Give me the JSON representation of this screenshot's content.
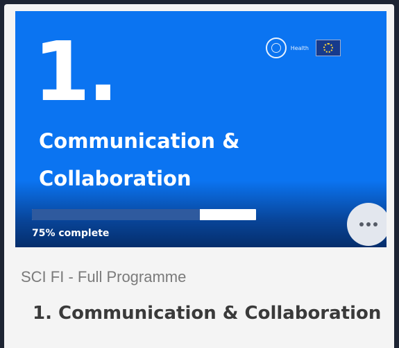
{
  "course_card": {
    "banner": {
      "number": "1.",
      "title": "Communication & Collaboration",
      "logo_text": "Health"
    },
    "progress": {
      "percent": 75,
      "label": "75% complete"
    },
    "category": "SCI FI - Full Programme",
    "title": "1. Communication & Collaboration"
  },
  "colors": {
    "background": "#1d2433",
    "card": "#f4f4f4",
    "banner": "#0b74f1",
    "progress_fill": "#2f5a9e",
    "progress_track": "#ffffff",
    "more_button": "#e3e7ee"
  },
  "icons": {
    "more": "more-horizontal-icon",
    "eit_logo": "eit-health-logo",
    "eu_flag": "eu-flag-icon"
  }
}
